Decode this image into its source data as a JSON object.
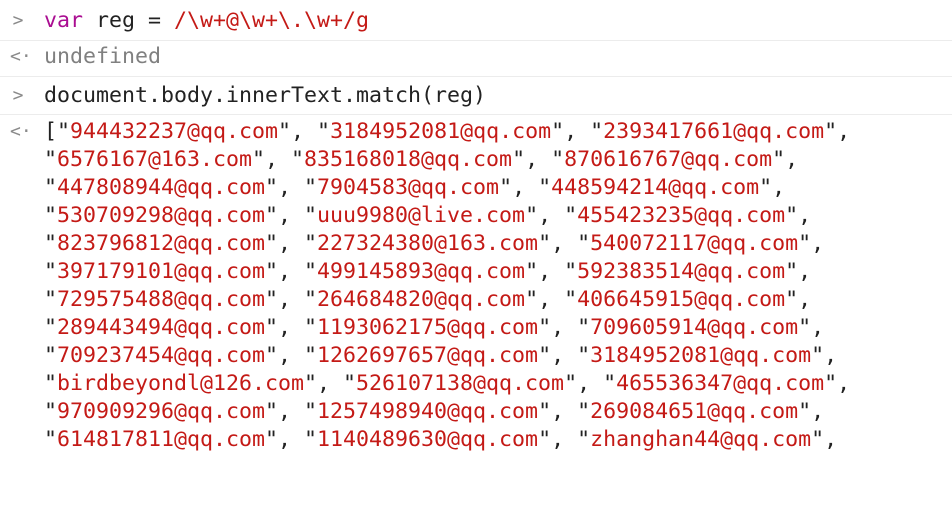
{
  "colors": {
    "keyword": "#aa0d91",
    "string": "#c41a16",
    "text": "#222222",
    "muted": "#808080",
    "prompt": "#8a8a8a"
  },
  "icons": {
    "input_prompt": "chevron-right-icon",
    "output_prompt": "return-arrow-icon"
  },
  "console": {
    "input_glyph": ">",
    "output_glyph": "<·",
    "entry1": {
      "keyword": "var",
      "rest": " reg = ",
      "regex": "/\\w+@\\w+\\.\\w+/g"
    },
    "entry2": {
      "result": "undefined"
    },
    "entry3": {
      "code": "document.body.innerText.match(reg)"
    },
    "entry4": {
      "open": "[",
      "emails": [
        "944432237@qq.com",
        "3184952081@qq.com",
        "2393417661@qq.com",
        "6576167@163.com",
        "835168018@qq.com",
        "870616767@qq.com",
        "447808944@qq.com",
        "7904583@qq.com",
        "448594214@qq.com",
        "530709298@qq.com",
        "uuu9980@live.com",
        "455423235@qq.com",
        "823796812@qq.com",
        "227324380@163.com",
        "540072117@qq.com",
        "397179101@qq.com",
        "499145893@qq.com",
        "592383514@qq.com",
        "729575488@qq.com",
        "264684820@qq.com",
        "406645915@qq.com",
        "289443494@qq.com",
        "1193062175@qq.com",
        "709605914@qq.com",
        "709237454@qq.com",
        "1262697657@qq.com",
        "3184952081@qq.com",
        "birdbeyondl@126.com",
        "526107138@qq.com",
        "465536347@qq.com",
        "970909296@qq.com",
        "1257498940@qq.com",
        "269084651@qq.com",
        "614817811@qq.com",
        "1140489630@qq.com",
        "zhanghan44@qq.com"
      ]
    }
  }
}
